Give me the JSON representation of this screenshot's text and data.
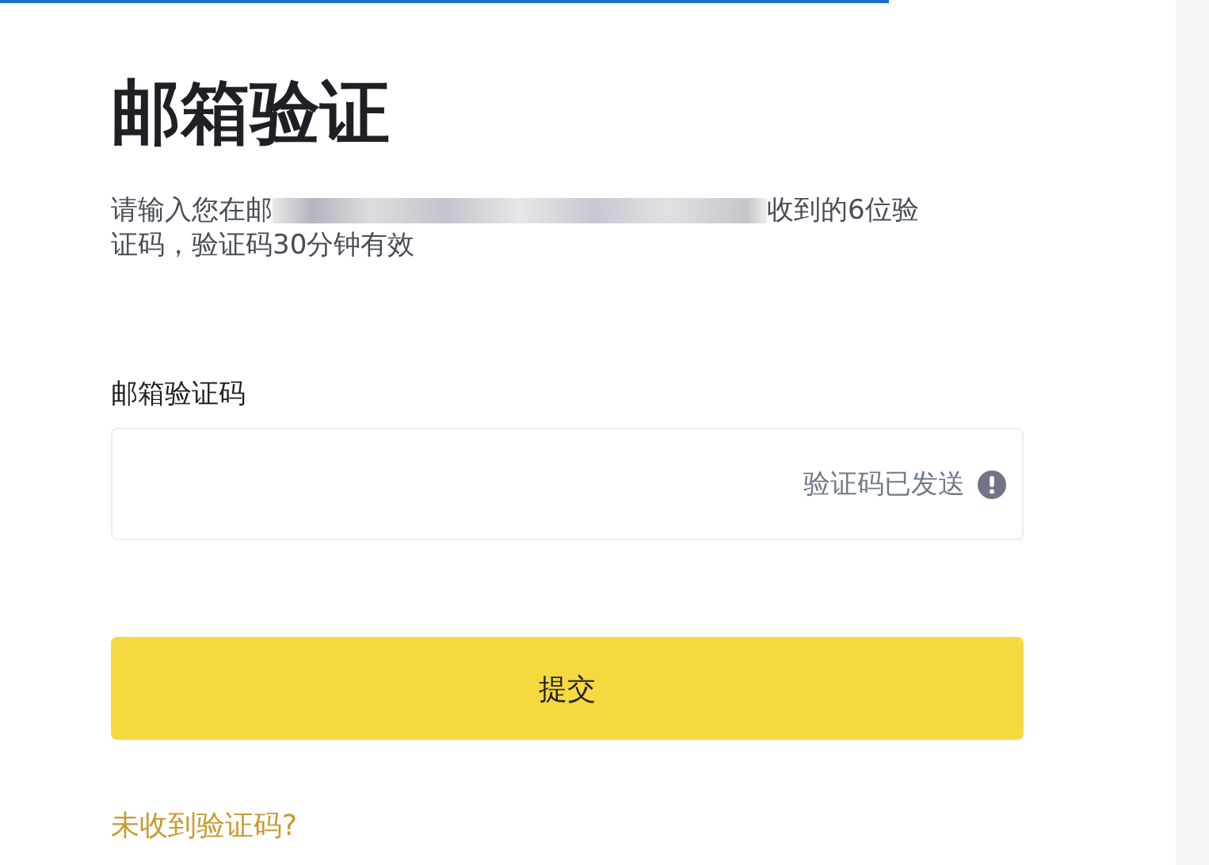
{
  "title": "邮箱验证",
  "description": {
    "before": "请输入您在邮",
    "after": "收到的6位验",
    "line_2": "证码，验证码30分钟有效"
  },
  "field": {
    "label": "邮箱验证码",
    "status": "验证码已发送"
  },
  "buttons": [
    {
      "label": "提交"
    }
  ],
  "link": "未收到验证码?"
}
